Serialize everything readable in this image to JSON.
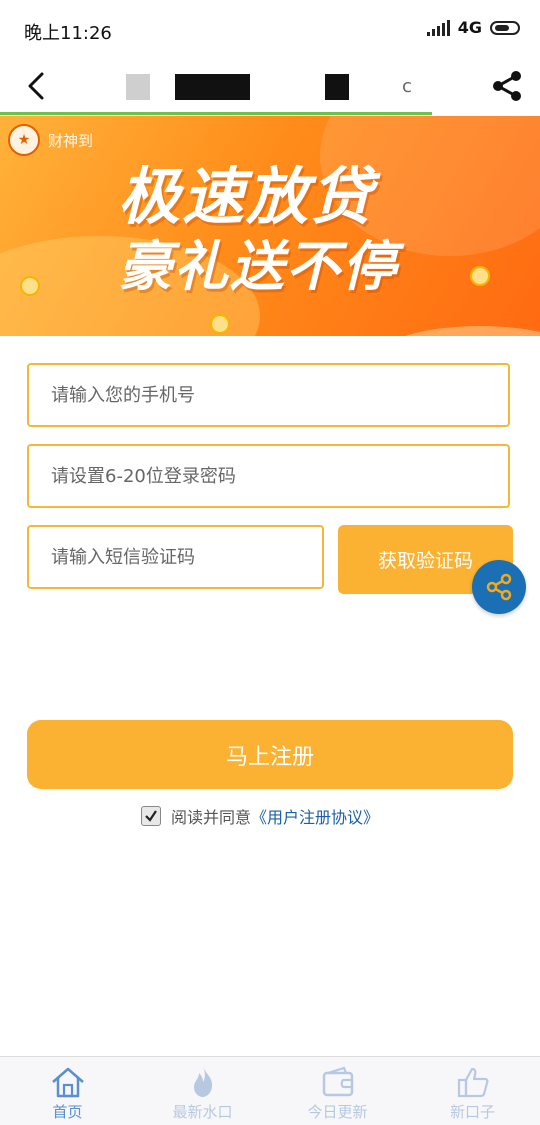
{
  "status_bar": {
    "time": "晚上11:26",
    "network": "4G"
  },
  "nav": {
    "partial_char": "c"
  },
  "banner": {
    "brand": "财神到",
    "line1": "极速放贷",
    "line2": "豪礼送不停"
  },
  "form": {
    "phone_placeholder": "请输入您的手机号",
    "password_placeholder": "请设置6-20位登录密码",
    "sms_placeholder": "请输入短信验证码",
    "get_code_label": "获取验证码",
    "register_label": "马上注册",
    "agree_text": "阅读并同意",
    "agreement_link": "《用户注册协议》",
    "agree_checked": true
  },
  "tabbar": {
    "items": [
      {
        "label": "首页",
        "icon": "home-icon",
        "active": true
      },
      {
        "label": "最新水口",
        "icon": "flame-icon",
        "active": false
      },
      {
        "label": "今日更新",
        "icon": "wallet-icon",
        "active": false
      },
      {
        "label": "新口子",
        "icon": "thumbs-up-icon",
        "active": false
      }
    ]
  },
  "colors": {
    "accent": "#fbb131",
    "border": "#f5b63a",
    "link": "#1a5fa8",
    "tab_active": "#5a8fd0",
    "tab_inactive": "#b7c9e0"
  }
}
